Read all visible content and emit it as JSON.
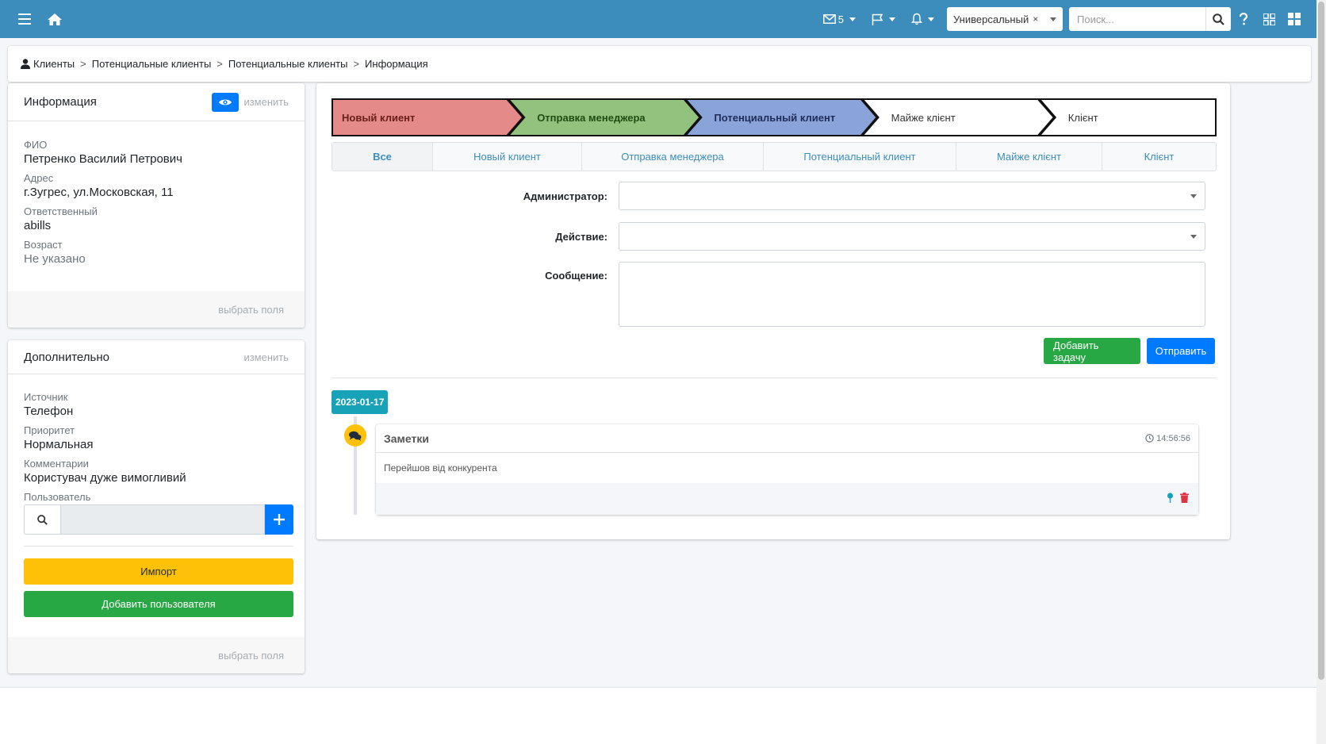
{
  "topnav": {
    "mail_count": "5",
    "select_value": "Универсальный",
    "select_clear": "×",
    "search_placeholder": "Поиск..."
  },
  "breadcrumb": [
    "Клиенты",
    "Потенциальные клиенты",
    "Потенциальные клиенты",
    "Информация"
  ],
  "breadcrumb_sep": ">",
  "info_card": {
    "title": "Информация",
    "edit": "изменить",
    "fields": [
      {
        "label": "ФИО",
        "value": "Петренко Василий Петрович"
      },
      {
        "label": "Адрес",
        "value": "г.Зугрес, ул.Московская, 11"
      },
      {
        "label": "Ответственный",
        "value": "abills"
      },
      {
        "label": "Возраст",
        "value": "Не указано"
      }
    ],
    "footer_link": "выбрать поля"
  },
  "extra_card": {
    "title": "Дополнительно",
    "edit": "изменить",
    "fields": [
      {
        "label": "Источник",
        "value": "Телефон"
      },
      {
        "label": "Приоритет",
        "value": "Нормальная"
      },
      {
        "label": "Комментарии",
        "value": "Користувач дуже вимогливий"
      }
    ],
    "user_label": "Пользователь",
    "import_button": "Импорт",
    "add_user_button": "Добавить пользователя",
    "footer_link": "выбрать поля"
  },
  "pipeline": {
    "steps": [
      {
        "label": "Новый клиент",
        "color": "#e48a88"
      },
      {
        "label": "Отправка менеджера",
        "color": "#92c27d"
      },
      {
        "label": "Потенциальный клиент",
        "color": "#8aa3d8"
      },
      {
        "label": "Майже клієнт",
        "color": "#ffffff"
      },
      {
        "label": "Клієнт",
        "color": "#ffffff"
      }
    ]
  },
  "tabs": [
    "Все",
    "Новый клиент",
    "Отправка менеджера",
    "Потенциальный клиент",
    "Майже клієнт",
    "Клієнт"
  ],
  "form": {
    "admin_label": "Администратор:",
    "action_label": "Действие:",
    "message_label": "Сообщение:",
    "add_task_button": "Добавить задачу",
    "send_button": "Отправить"
  },
  "timeline": {
    "date": "2023-01-17",
    "item": {
      "title": "Заметки",
      "time": "14:56:56",
      "body": "Перейшов від конкурента"
    }
  },
  "colors": {
    "nav": "#3c8dbc",
    "primary": "#007bff",
    "success": "#28a745",
    "warning": "#ffc107",
    "info": "#17a2b8",
    "danger": "#dc3545"
  }
}
